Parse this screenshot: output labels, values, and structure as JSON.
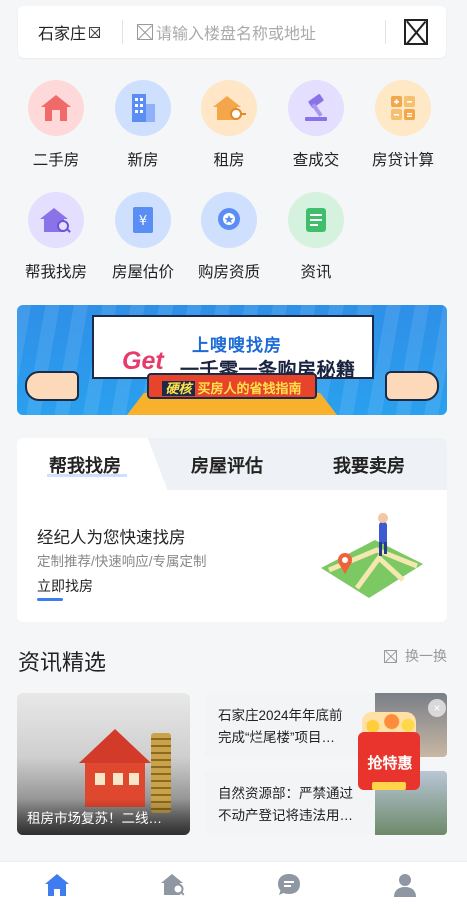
{
  "search": {
    "city": "石家庄",
    "placeholder": "请输入楼盘名称或地址"
  },
  "grid": [
    {
      "label": "二手房",
      "icon": "house-icon",
      "color": "#ffd3d3"
    },
    {
      "label": "新房",
      "icon": "building-icon",
      "color": "#cfe0ff"
    },
    {
      "label": "租房",
      "icon": "key-house-icon",
      "color": "#ffe4c4"
    },
    {
      "label": "查成交",
      "icon": "gavel-icon",
      "color": "#e2dcff"
    },
    {
      "label": "房贷计算",
      "icon": "calculator-icon",
      "color": "#ffe6c2"
    },
    {
      "label": "帮我找房",
      "icon": "house-search-icon",
      "color": "#e2dcff"
    },
    {
      "label": "房屋估价",
      "icon": "valuation-icon",
      "color": "#cfe0ff"
    },
    {
      "label": "购房资质",
      "icon": "qualification-icon",
      "color": "#cfe0ff"
    },
    {
      "label": "资讯",
      "icon": "news-icon",
      "color": "#d5f2de"
    }
  ],
  "banner": {
    "top": "上嗖嗖找房",
    "get": "Get",
    "title": "一千零一条购房秘籍",
    "badge": "硬核",
    "ribbon": "买房人的省钱指南"
  },
  "tabs": {
    "items": [
      "帮我找房",
      "房屋评估",
      "我要卖房"
    ],
    "active": 0,
    "title": "经纪人为您快速找房",
    "subtitle": "定制推荐/快速响应/专属定制",
    "link": "立即找房"
  },
  "news": {
    "heading": "资讯精选",
    "refresh": "换一换",
    "featured_caption": "租房市场复苏！二线…",
    "items": [
      {
        "line1": "石家庄2024年年底前",
        "line2": "完成“烂尾楼”项目…"
      },
      {
        "line1": "自然资源部：严禁通过",
        "line2": "不动产登记将违法用…"
      }
    ]
  },
  "promo": {
    "label": "抢特惠",
    "close": "×"
  },
  "bottom_nav": [
    {
      "icon": "home-icon",
      "active": true
    },
    {
      "icon": "house-search-icon",
      "active": false
    },
    {
      "icon": "chat-icon",
      "active": false
    },
    {
      "icon": "user-icon",
      "active": false
    }
  ],
  "colors": {
    "accent": "#3e7cf0",
    "promo_red": "#e8342c"
  }
}
